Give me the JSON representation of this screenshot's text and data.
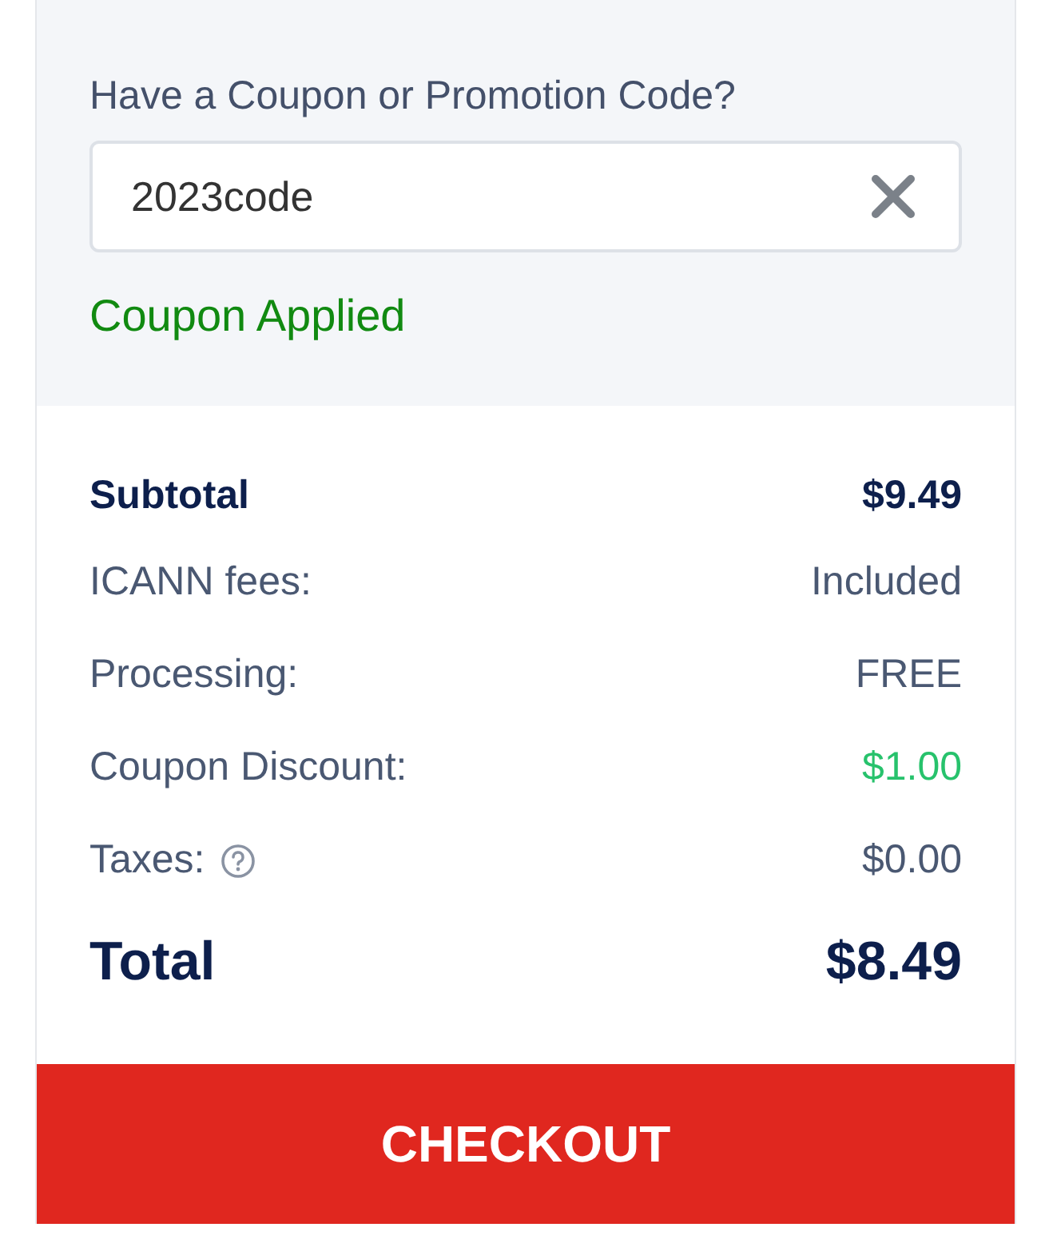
{
  "coupon": {
    "label": "Have a Coupon or Promotion Code?",
    "value": "2023code",
    "status": "Coupon Applied"
  },
  "summary": [
    {
      "kind": "subtotal",
      "label": "Subtotal",
      "value": "$9.49"
    },
    {
      "kind": "line",
      "label": "ICANN fees:",
      "value": "Included"
    },
    {
      "kind": "line",
      "label": "Processing:",
      "value": "FREE"
    },
    {
      "kind": "discount",
      "label": "Coupon Discount:",
      "value": "$1.00"
    },
    {
      "kind": "line",
      "label": "Taxes:",
      "value": "$0.00",
      "info": true
    },
    {
      "kind": "total",
      "label": "Total",
      "value": "$8.49"
    }
  ],
  "checkout_button": "CHECKOUT"
}
